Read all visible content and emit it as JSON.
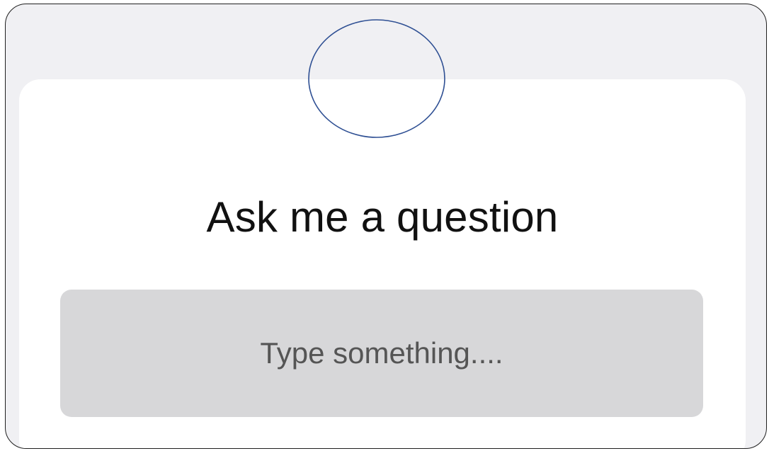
{
  "prompt": {
    "title": "Ask me a question",
    "input_placeholder": "Type something...."
  },
  "colors": {
    "background": "#f0f0f3",
    "card": "#ffffff",
    "input_fill": "#d7d7d9",
    "avatar_outline": "#2e4f93"
  }
}
